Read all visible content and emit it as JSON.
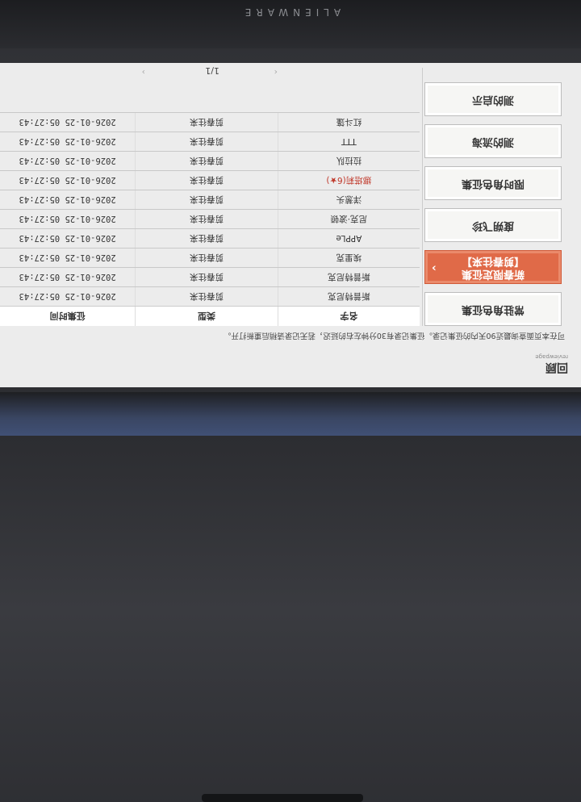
{
  "device": {
    "brand": "ALIENWARE"
  },
  "header": {
    "title": "回顾",
    "subtitle": "reviewpage",
    "description": "可在本页面查询最近90天内的征集记录。征集记录有30分钟左右的延迟，若无记录请稍后重新打开。"
  },
  "menu": {
    "items": [
      {
        "label": "常驻角色征集",
        "active": false
      },
      {
        "label": "新春限定征集\n【剪春往来】",
        "active": true
      },
      {
        "label": "度朔飞珍",
        "active": false
      },
      {
        "label": "限时角色征集",
        "active": false
      },
      {
        "label": "测的流海",
        "active": false
      },
      {
        "label": "测的启示",
        "active": false
      }
    ]
  },
  "table": {
    "headers": [
      "名字",
      "类型",
      "征集时间"
    ],
    "rows": [
      {
        "name": "斯普特尼克",
        "type": "剪春往来",
        "time": "2026-01-25 05:27:43",
        "highlight": false
      },
      {
        "name": "斯普特尼克",
        "type": "剪春往来",
        "time": "2026-01-25 05:27:43",
        "highlight": false
      },
      {
        "name": "埃里克",
        "type": "剪春往来",
        "time": "2026-01-25 05:27:43",
        "highlight": false
      },
      {
        "name": "APPLe",
        "type": "剪春往来",
        "time": "2026-01-25 05:27:43",
        "highlight": false
      },
      {
        "name": "尼克·波顿",
        "type": "剪春往来",
        "time": "2026-01-25 05:27:43",
        "highlight": false
      },
      {
        "name": "洋葱头",
        "type": "剪春往来",
        "time": "2026-01-25 05:27:43",
        "highlight": false
      },
      {
        "name": "娜塔莉(6★)",
        "type": "剪春往来",
        "time": "2026-01-25 05:27:43",
        "highlight": true
      },
      {
        "name": "拉拉队",
        "type": "剪春往来",
        "time": "2026-01-25 05:27:43",
        "highlight": false
      },
      {
        "name": "TTT",
        "type": "剪春往来",
        "time": "2026-01-25 05:27:43",
        "highlight": false
      },
      {
        "name": "红斗篷",
        "type": "剪春往来",
        "time": "2026-01-25 05:27:43",
        "highlight": false
      }
    ]
  },
  "pager": {
    "prev": "‹",
    "page": "1/1",
    "next": "›"
  }
}
